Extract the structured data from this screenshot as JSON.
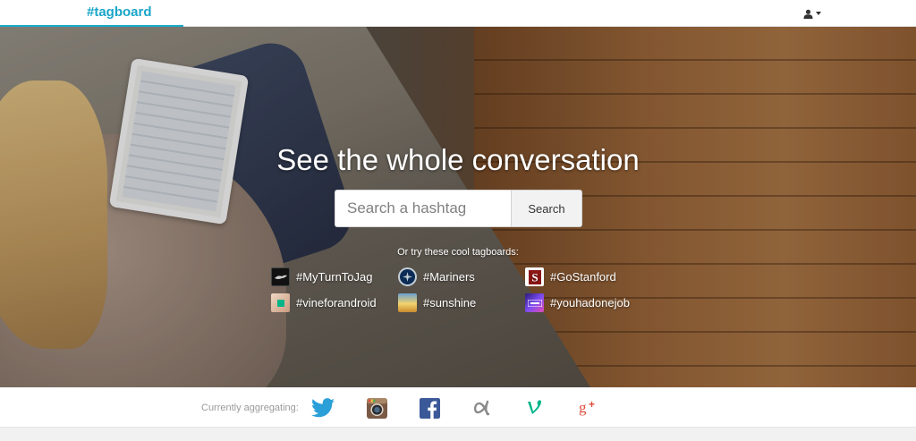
{
  "brand": "#tagboard",
  "hero": {
    "headline": "See the whole conversation",
    "search_placeholder": "Search a hashtag",
    "search_button": "Search",
    "try_label": "Or try these cool tagboards:"
  },
  "tagboards": [
    {
      "tag": "#MyTurnToJag",
      "thumb_color": "#111111",
      "icon": "jaguar-logo-icon"
    },
    {
      "tag": "#Mariners",
      "thumb_color": "#0c2c56",
      "icon": "mariners-logo-icon"
    },
    {
      "tag": "#GoStanford",
      "thumb_color": "#8c1515",
      "icon": "stanford-logo-icon"
    },
    {
      "tag": "#vineforandroid",
      "thumb_color": "#d9b49a",
      "icon": "vine-android-icon"
    },
    {
      "tag": "#sunshine",
      "thumb_color": "#e8b84a",
      "icon": "sunshine-photo-icon"
    },
    {
      "tag": "#youhadonejob",
      "thumb_color": "#5b3fd6",
      "icon": "youhadonejob-photo-icon"
    }
  ],
  "footer": {
    "aggregating_label": "Currently aggregating:",
    "networks": [
      {
        "name": "twitter",
        "icon": "twitter-icon",
        "color": "#2a9fd8"
      },
      {
        "name": "instagram",
        "icon": "instagram-icon",
        "color": "#7a5a45"
      },
      {
        "name": "facebook",
        "icon": "facebook-icon",
        "color": "#3b5998"
      },
      {
        "name": "app.net",
        "icon": "appnet-icon",
        "color": "#8a8a8a"
      },
      {
        "name": "vine",
        "icon": "vine-icon",
        "color": "#00b488"
      },
      {
        "name": "google-plus",
        "icon": "google-plus-icon",
        "color": "#dd4b39"
      }
    ]
  },
  "colors": {
    "brand": "#1aa6c8",
    "accent_line": "#18a9c9"
  }
}
